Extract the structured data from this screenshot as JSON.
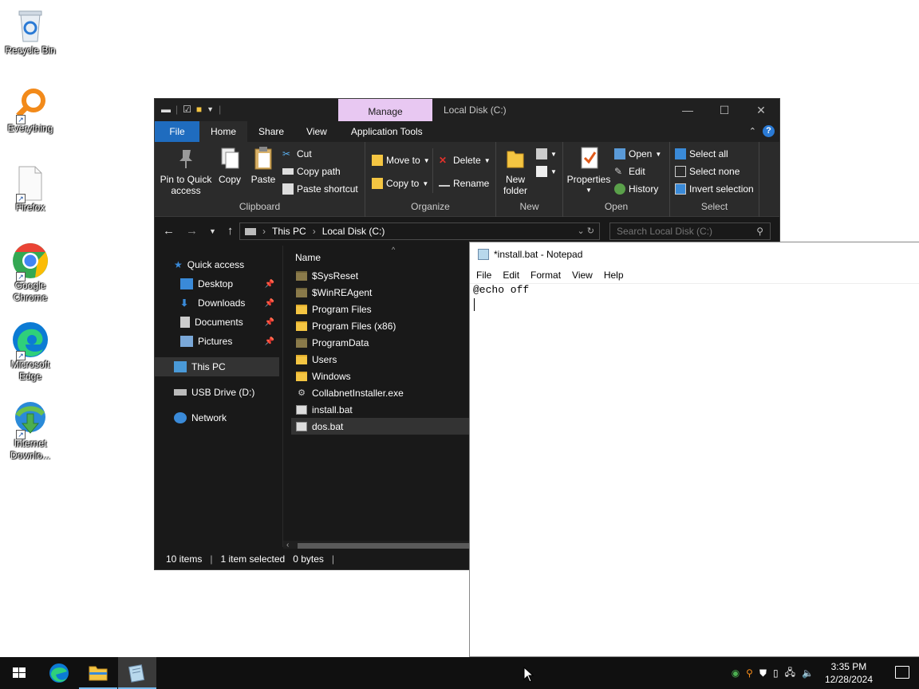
{
  "desktop": {
    "icons": [
      {
        "label": "Recycle Bin",
        "icon": "recycle-bin-icon"
      },
      {
        "label": "Everything",
        "icon": "everything-search-icon"
      },
      {
        "label": "Firefox",
        "icon": "blank-file-icon"
      },
      {
        "label": "Google Chrome",
        "icon": "chrome-icon"
      },
      {
        "label": "Microsoft Edge",
        "icon": "edge-icon"
      },
      {
        "label": "Internet Downlo...",
        "icon": "internet-download-manager-icon"
      }
    ]
  },
  "explorer": {
    "title": "Local Disk (C:)",
    "context_tab": "Manage",
    "tabs": [
      "File",
      "Home",
      "Share",
      "View",
      "Application Tools"
    ],
    "ribbon": {
      "clipboard": {
        "group": "Clipboard",
        "pin": "Pin to Quick access",
        "copy": "Copy",
        "paste": "Paste",
        "cut": "Cut",
        "copy_path": "Copy path",
        "paste_shortcut": "Paste shortcut"
      },
      "organize": {
        "group": "Organize",
        "move_to": "Move to",
        "copy_to": "Copy to",
        "delete": "Delete",
        "rename": "Rename"
      },
      "new": {
        "group": "New",
        "new_folder": "New folder"
      },
      "open": {
        "group": "Open",
        "properties": "Properties",
        "open": "Open",
        "edit": "Edit",
        "history": "History"
      },
      "select": {
        "group": "Select",
        "select_all": "Select all",
        "select_none": "Select none",
        "invert": "Invert selection"
      }
    },
    "address": {
      "crumbs": [
        "This PC",
        "Local Disk (C:)"
      ]
    },
    "search": {
      "placeholder": "Search Local Disk (C:)"
    },
    "nav": {
      "quick_access": "Quick access",
      "desktop": "Desktop",
      "downloads": "Downloads",
      "documents": "Documents",
      "pictures": "Pictures",
      "this_pc": "This PC",
      "usb": "USB Drive (D:)",
      "network": "Network"
    },
    "column_name": "Name",
    "files": [
      {
        "name": "$SysReset",
        "type": "folder-hidden"
      },
      {
        "name": "$WinREAgent",
        "type": "folder-hidden"
      },
      {
        "name": "Program Files",
        "type": "folder"
      },
      {
        "name": "Program Files (x86)",
        "type": "folder"
      },
      {
        "name": "ProgramData",
        "type": "folder-hidden"
      },
      {
        "name": "Users",
        "type": "folder"
      },
      {
        "name": "Windows",
        "type": "folder"
      },
      {
        "name": "CollabnetInstaller.exe",
        "type": "exe"
      },
      {
        "name": "install.bat",
        "type": "bat"
      },
      {
        "name": "dos.bat",
        "type": "bat",
        "selected": true
      }
    ],
    "status": {
      "items": "10 items",
      "selected": "1 item selected",
      "size": "0 bytes"
    }
  },
  "notepad": {
    "title": "*install.bat - Notepad",
    "menu": [
      "File",
      "Edit",
      "Format",
      "View",
      "Help"
    ],
    "content": "@echo off"
  },
  "taskbar": {
    "time": "3:35 PM",
    "date": "12/28/2024"
  }
}
